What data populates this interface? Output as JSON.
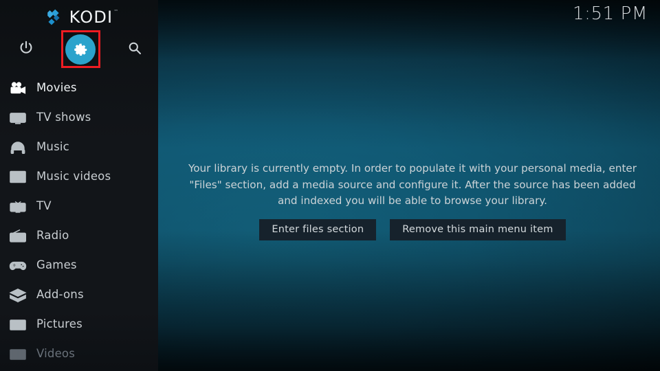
{
  "app": {
    "name": "KODI",
    "trademark": "™",
    "logo_icon": "kodi-logo-mark",
    "accent_color": "#2ba3cc",
    "highlight_color": "#ee1c22",
    "sidebar_bg": "#121519"
  },
  "clock": {
    "time": "1:51 PM"
  },
  "toolbar": {
    "buttons": [
      {
        "name": "power-button",
        "icon": "power-icon",
        "label": "Power",
        "active": false
      },
      {
        "name": "settings-button",
        "icon": "gear-icon",
        "label": "Settings",
        "active": true
      },
      {
        "name": "search-button",
        "icon": "search-icon",
        "label": "Search",
        "active": false
      }
    ]
  },
  "sidebar": {
    "items": [
      {
        "label": "Movies",
        "icon": "movie-camera-icon",
        "level": "lvl-hi"
      },
      {
        "label": "TV shows",
        "icon": "tv-monitor-icon",
        "level": "lvl-mid"
      },
      {
        "label": "Music",
        "icon": "headphones-icon",
        "level": "lvl-mid"
      },
      {
        "label": "Music videos",
        "icon": "music-video-icon",
        "level": "lvl-mid"
      },
      {
        "label": "TV",
        "icon": "television-icon",
        "level": "lvl-mid"
      },
      {
        "label": "Radio",
        "icon": "radio-icon",
        "level": "lvl-mid"
      },
      {
        "label": "Games",
        "icon": "gamepad-icon",
        "level": "lvl-mid"
      },
      {
        "label": "Add-ons",
        "icon": "addon-box-icon",
        "level": "lvl-mid"
      },
      {
        "label": "Pictures",
        "icon": "picture-frame-icon",
        "level": "lvl-mid"
      },
      {
        "label": "Videos",
        "icon": "film-strip-icon",
        "level": "lvl-lo2"
      }
    ]
  },
  "main": {
    "empty_message": "Your library is currently empty. In order to populate it with your personal media, enter \"Files\" section, add a media source and configure it. After the source has been added and indexed you will be able to browse your library.",
    "buttons": [
      {
        "label": "Enter files section"
      },
      {
        "label": "Remove this main menu item"
      }
    ]
  }
}
